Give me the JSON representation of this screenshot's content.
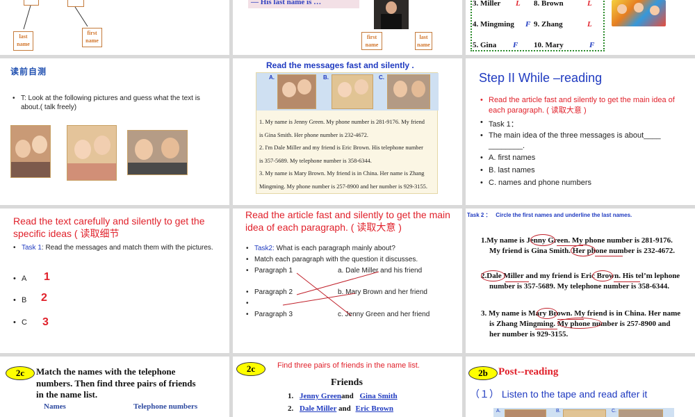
{
  "s1": {
    "box_left": "last name",
    "box_right": "first name"
  },
  "s2": {
    "caption": "— His last name is …",
    "box_left": "first name",
    "box_right": "last name"
  },
  "s3": {
    "rows": [
      {
        "l": "3.  Miller",
        "lm": "L",
        "r": "8. Brown",
        "rm": "L"
      },
      {
        "l": "4.  Mingming",
        "lm": "F",
        "r": "9. Zhang",
        "rm": "L"
      },
      {
        "l": "5.  Gina",
        "lm": "F",
        "r": "10. Mary",
        "rm": "F"
      }
    ]
  },
  "s4": {
    "title": "读前自测",
    "bullet": "T: Look at the following pictures and guess what the text is about.( talk freely)"
  },
  "s5": {
    "title": "Read the messages fast and silently .",
    "labels": [
      "A.",
      "B.",
      "C."
    ],
    "messages": [
      "1. My name is Jenny Green. My phone number is 281-9176. My friend is Gina Smith. Her phone number is 232-4672.",
      "2. I'm Dale Miller and my friend is Eric Brown. His telephone number is 357-5689. My telephone number is 358-6344.",
      "3. My name is Mary Brown. My friend is in China. Her name is Zhang Mingming. My phone number is 257-8900 and her number is 929-3155."
    ]
  },
  "s6": {
    "title": "Step II While –reading",
    "red_bullet": "Read the article fast and silently to get the main idea of each paragraph. ( 读取大意 )",
    "task": "Task 1：",
    "question": "The main idea of the three messages is about____ ________.",
    "options": [
      "A. first names",
      "B. last names",
      "C. names and phone numbers"
    ]
  },
  "s7": {
    "title": "Read the text carefully and silently to get the specific ideas ( 读取细节",
    "task_label": "Task 1",
    "task_text": ": Read the messages and match them with the pictures.",
    "items": [
      {
        "letter": "A",
        "num": "1"
      },
      {
        "letter": "B",
        "num": "2"
      },
      {
        "letter": "C",
        "num": "3"
      }
    ]
  },
  "s8": {
    "title": "Read the article fast and silently to get the main idea of each paragraph. ( 读取大意 )",
    "task_label": "Task2:",
    "task_text": " What is each paragraph mainly about?",
    "line2": "Match each paragraph with the question it discusses.",
    "paragraphs": [
      "Paragraph 1",
      "Paragraph 2",
      "",
      "Paragraph 3"
    ],
    "answers": [
      "a. Dale Miller and his friend",
      "b. Mary Brown and her friend",
      "c. Jenny Green and her friend"
    ]
  },
  "s9": {
    "title": "Task 2 ：   Circle the first names and underline the last names.",
    "p1": "1.My name is Jenny Green. My phone number is 281-9176. My friend is Gina Smith. Her phone number is 232-4672.",
    "p2": "2.Dale Miller and my friend is Eric Brown. His tel’m lephone number is 357-5689. My telephone number is 358-6344.",
    "p3": "3. My name is Mary Brown. My friend is in China. Her name is Zhang Mingming. My phone number is 257-8900 and her number is 929-3155."
  },
  "s10": {
    "badge": "2c",
    "title": "Match the names with the telephone numbers. Then find three pairs of friends in the name list.",
    "col1": "Names",
    "col2": "Telephone numbers"
  },
  "s11": {
    "badge": "2c",
    "title": "Find three pairs of friends in the name list.",
    "heading": "Friends",
    "rows": [
      {
        "n": "1.",
        "a": "Jenny Green",
        "and": "and",
        "b": "Gina Smith"
      },
      {
        "n": "2.",
        "a": "Dale Miller",
        "and": "and",
        "b": "Eric Brown"
      }
    ]
  },
  "s12": {
    "badge": "2b",
    "title": "Post--reading",
    "sub": "（１） Listen to the tape and read after it",
    "labels": [
      "A.",
      "B.",
      "C."
    ]
  }
}
